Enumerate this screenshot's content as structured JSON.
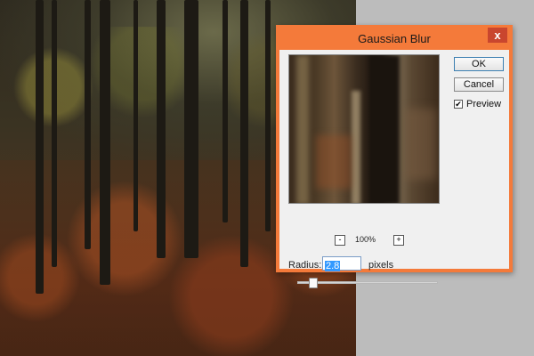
{
  "dialog": {
    "title": "Gaussian Blur",
    "close_glyph": "x",
    "ok_label": "OK",
    "cancel_label": "Cancel",
    "preview_label": "Preview",
    "preview_checked": true,
    "checkbox_glyph": "✔",
    "zoom": {
      "value": "100%",
      "zoom_out_glyph": "-",
      "zoom_in_glyph": "+"
    },
    "radius": {
      "label": "Radius:",
      "value": "2.8",
      "unit": "pixels"
    }
  },
  "colors": {
    "titlebar": "#f47a3a",
    "close_button": "#c9462e",
    "selection": "#3399ff"
  },
  "icons": [
    "close-icon",
    "zoom-out-icon",
    "zoom-in-icon",
    "checkmark-icon"
  ]
}
